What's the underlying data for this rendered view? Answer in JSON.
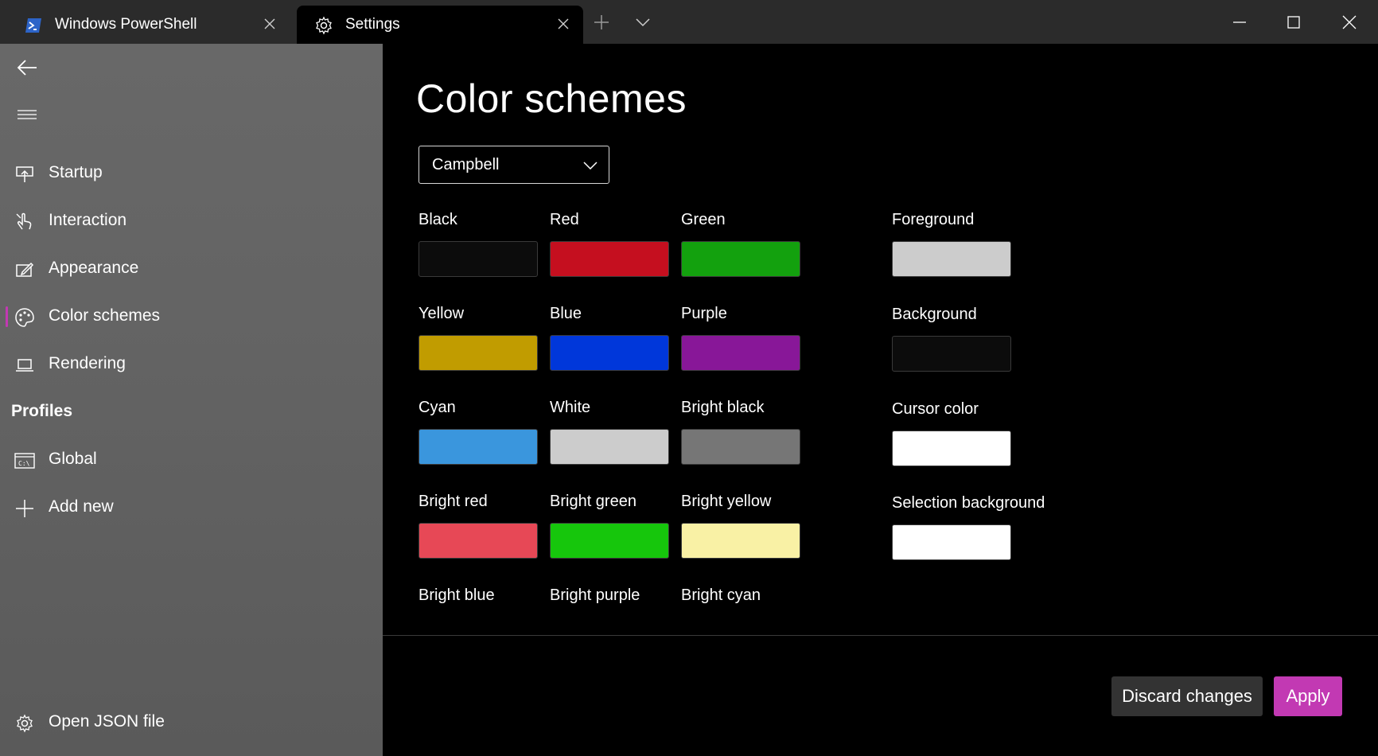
{
  "tabs": [
    {
      "label": "Windows PowerShell",
      "icon": "powershell-icon"
    },
    {
      "label": "Settings",
      "icon": "gear-icon"
    }
  ],
  "sidebar": {
    "items": [
      {
        "label": "Startup",
        "icon": "startup-icon"
      },
      {
        "label": "Interaction",
        "icon": "touch-icon"
      },
      {
        "label": "Appearance",
        "icon": "edit-icon"
      },
      {
        "label": "Color schemes",
        "icon": "palette-icon",
        "selected": true
      },
      {
        "label": "Rendering",
        "icon": "laptop-icon"
      }
    ],
    "profiles_header": "Profiles",
    "profiles": [
      {
        "label": "Global",
        "icon": "console-icon"
      },
      {
        "label": "Add new",
        "icon": "plus-icon"
      }
    ],
    "footer": {
      "label": "Open JSON file",
      "icon": "gear-icon"
    }
  },
  "main": {
    "title": "Color schemes",
    "scheme_select": {
      "value": "Campbell"
    },
    "colors": [
      {
        "label": "Black",
        "color": "#0c0c0c"
      },
      {
        "label": "Red",
        "color": "#c50f1f"
      },
      {
        "label": "Green",
        "color": "#13a10e"
      },
      {
        "label": "Yellow",
        "color": "#c19c00"
      },
      {
        "label": "Blue",
        "color": "#0037da"
      },
      {
        "label": "Purple",
        "color": "#881798"
      },
      {
        "label": "Cyan",
        "color": "#3a96dd"
      },
      {
        "label": "White",
        "color": "#cccccc"
      },
      {
        "label": "Bright black",
        "color": "#767676"
      },
      {
        "label": "Bright red",
        "color": "#e74856"
      },
      {
        "label": "Bright green",
        "color": "#16c60c"
      },
      {
        "label": "Bright yellow",
        "color": "#f9f1a5"
      },
      {
        "label": "Bright blue",
        "color": "#3b78ff"
      },
      {
        "label": "Bright purple",
        "color": "#b4009e"
      },
      {
        "label": "Bright cyan",
        "color": "#61d6d6"
      }
    ],
    "special_colors": [
      {
        "label": "Foreground",
        "color": "#cccccc"
      },
      {
        "label": "Background",
        "color": "#0c0c0c"
      },
      {
        "label": "Cursor color",
        "color": "#ffffff"
      },
      {
        "label": "Selection background",
        "color": "#ffffff"
      }
    ],
    "buttons": {
      "discard": "Discard changes",
      "apply": "Apply"
    }
  },
  "theme": {
    "accent": "#c239b3",
    "sidebar_bg": "#636363",
    "titlebar_bg": "#2b2b2b"
  }
}
